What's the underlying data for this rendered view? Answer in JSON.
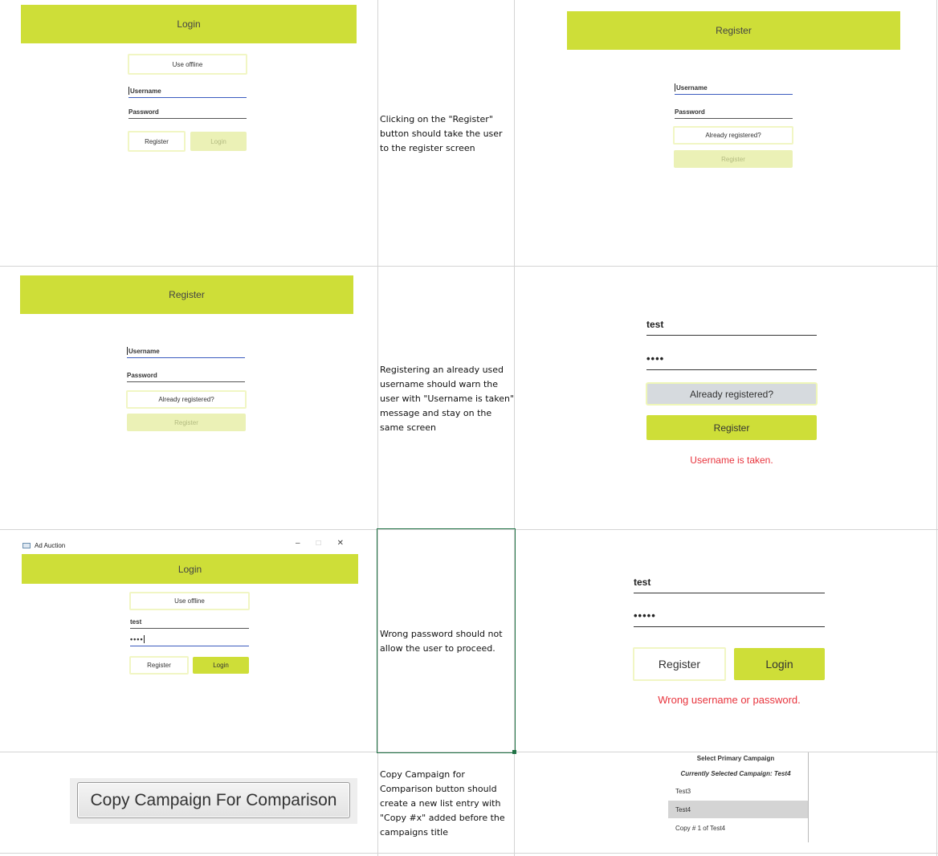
{
  "row1": {
    "login_screen": {
      "header": "Login",
      "use_offline": "Use offline",
      "username_placeholder": "Username",
      "password_placeholder": "Password",
      "register_label": "Register",
      "login_label": "Login"
    },
    "description": "Clicking on the \"Register\" button should take the user to the register screen",
    "register_screen": {
      "header": "Register",
      "username_placeholder": "Username",
      "password_placeholder": "Password",
      "already_registered": "Already registered?",
      "register_label": "Register"
    }
  },
  "row2": {
    "register_screen": {
      "header": "Register",
      "username_placeholder": "Username",
      "password_placeholder": "Password",
      "already_registered": "Already registered?",
      "register_label": "Register"
    },
    "description": "Registering an already used username should warn the user with \"Username is taken\" message and stay on the same screen",
    "result": {
      "username_value": "test",
      "password_value": "••••",
      "already_registered": "Already registered?",
      "register_label": "Register",
      "error": "Username is taken."
    }
  },
  "row3": {
    "window": {
      "title": "Ad Auction",
      "minimize": "–",
      "maximize": "□",
      "close": "✕",
      "header": "Login",
      "use_offline": "Use offline",
      "username_value": "test",
      "password_value": "••••",
      "register_label": "Register",
      "login_label": "Login"
    },
    "description": "Wrong password should not allow the user to proceed.",
    "result": {
      "username_value": "test",
      "password_value": "•••••",
      "register_label": "Register",
      "login_label": "Login",
      "error": "Wrong username or password."
    }
  },
  "row4": {
    "copy_button_label": "Copy Campaign For Comparison",
    "description": "Copy Campaign for Comparison button should create a new list entry with \"Copy #x\" added before the campaigns title",
    "list": {
      "title": "Select Primary Campaign",
      "current": "Currently Selected Campaign: Test4",
      "items": [
        "Test3",
        "Test4",
        "Copy # 1 of Test4"
      ],
      "selected_index": 1
    }
  }
}
